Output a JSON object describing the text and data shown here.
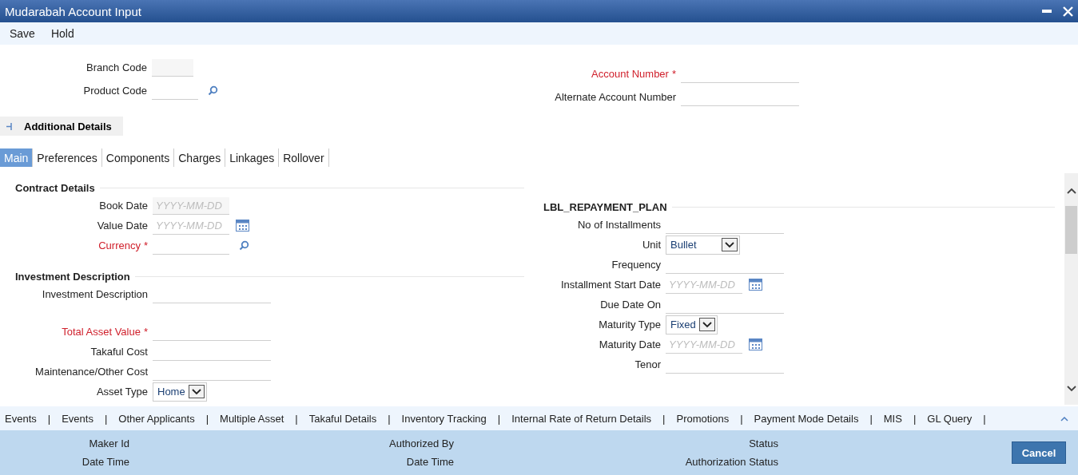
{
  "window": {
    "title": "Mudarabah Account Input"
  },
  "menu": [
    "Save",
    "Hold"
  ],
  "header_left": [
    {
      "label": "Branch Code",
      "required": false,
      "kind": "readonly"
    },
    {
      "label": "Product Code",
      "required": false,
      "kind": "lookup"
    }
  ],
  "header_right": [
    {
      "label": "Account Number",
      "required": true,
      "kind": "text"
    },
    {
      "label": "Alternate Account Number",
      "required": false,
      "kind": "text"
    }
  ],
  "additional_details": {
    "label": "Additional Details",
    "expanded": false
  },
  "tabs": [
    {
      "label": "Main",
      "selected": true
    },
    {
      "label": "Preferences",
      "selected": false
    },
    {
      "label": "Components",
      "selected": false
    },
    {
      "label": "Charges",
      "selected": false
    },
    {
      "label": "Linkages",
      "selected": false
    },
    {
      "label": "Rollover",
      "selected": false
    }
  ],
  "left_sections": [
    {
      "title": "Contract Details",
      "groups": [
        [
          {
            "label": "Book Date",
            "required": false,
            "kind": "readonly",
            "placeholder": "YYYY-MM-DD"
          },
          {
            "label": "Value Date",
            "required": false,
            "kind": "date",
            "placeholder": "YYYY-MM-DD"
          },
          {
            "label": "Currency",
            "required": true,
            "kind": "lookup"
          }
        ]
      ]
    },
    {
      "title": "Investment Description",
      "groups": [
        [
          {
            "label": "Investment Description",
            "required": false,
            "kind": "text"
          }
        ],
        [
          {
            "label": "Total Asset Value",
            "required": true,
            "kind": "text"
          },
          {
            "label": "Takaful Cost",
            "required": false,
            "kind": "text"
          },
          {
            "label": "Maintenance/Other Cost",
            "required": false,
            "kind": "text"
          },
          {
            "label": "Asset Type",
            "required": false,
            "kind": "select",
            "value": "Home"
          }
        ]
      ]
    }
  ],
  "right_sections": [
    {
      "title": "LBL_REPAYMENT_PLAN",
      "groups": [
        [
          {
            "label": "No of Installments",
            "required": false,
            "kind": "text"
          },
          {
            "label": "Unit",
            "required": false,
            "kind": "select",
            "value": "Bullet"
          },
          {
            "label": "Frequency",
            "required": false,
            "kind": "text"
          },
          {
            "label": "Installment Start Date",
            "required": false,
            "kind": "date",
            "placeholder": "YYYY-MM-DD"
          },
          {
            "label": "Due Date On",
            "required": false,
            "kind": "text"
          },
          {
            "label": "Maturity Type",
            "required": false,
            "kind": "select",
            "value": "Fixed"
          },
          {
            "label": "Maturity Date",
            "required": false,
            "kind": "date",
            "placeholder": "YYYY-MM-DD"
          },
          {
            "label": "Tenor",
            "required": false,
            "kind": "text"
          }
        ]
      ]
    }
  ],
  "footer_links": [
    "Events",
    "Events",
    "Other Applicants",
    "Multiple Asset",
    "Takaful Details",
    "Inventory Tracking",
    "Internal Rate of Return Details",
    "Promotions",
    "Payment Mode Details",
    "MIS",
    "GL Query"
  ],
  "audit": [
    [
      "Maker Id",
      "Date Time"
    ],
    [
      "Authorized By",
      "Date Time"
    ],
    [
      "Status",
      "Authorization Status"
    ]
  ],
  "cancel_button": "Cancel",
  "required_mark": "*",
  "link_separator": "|"
}
